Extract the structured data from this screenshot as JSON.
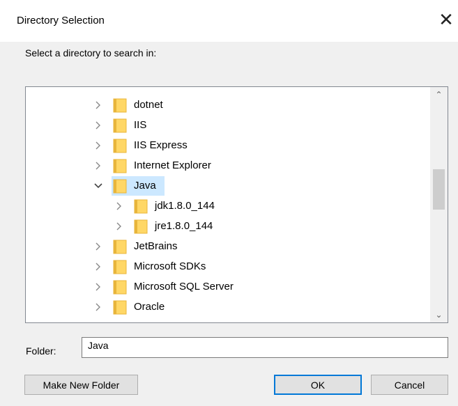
{
  "dialog": {
    "title": "Directory Selection",
    "close_glyph": "✕",
    "prompt": "Select a directory to search in:"
  },
  "tree": {
    "items": [
      {
        "label": "dotnet",
        "level": 0,
        "expanded": false,
        "selected": false
      },
      {
        "label": "IIS",
        "level": 0,
        "expanded": false,
        "selected": false
      },
      {
        "label": "IIS Express",
        "level": 0,
        "expanded": false,
        "selected": false
      },
      {
        "label": "Internet Explorer",
        "level": 0,
        "expanded": false,
        "selected": false
      },
      {
        "label": "Java",
        "level": 0,
        "expanded": true,
        "selected": true
      },
      {
        "label": "jdk1.8.0_144",
        "level": 1,
        "expanded": false,
        "selected": false
      },
      {
        "label": "jre1.8.0_144",
        "level": 1,
        "expanded": false,
        "selected": false
      },
      {
        "label": "JetBrains",
        "level": 0,
        "expanded": false,
        "selected": false
      },
      {
        "label": "Microsoft SDKs",
        "level": 0,
        "expanded": false,
        "selected": false
      },
      {
        "label": "Microsoft SQL Server",
        "level": 0,
        "expanded": false,
        "selected": false
      },
      {
        "label": "Oracle",
        "level": 0,
        "expanded": false,
        "selected": false
      }
    ],
    "scroll_up_glyph": "⌃",
    "scroll_down_glyph": "⌄"
  },
  "folder": {
    "label": "Folder:",
    "value": "Java"
  },
  "buttons": {
    "make_new_folder": "Make New Folder",
    "ok": "OK",
    "cancel": "Cancel"
  },
  "colors": {
    "selection": "#cce8ff",
    "folder_fill": "#ffd766",
    "folder_dark": "#e8b53b",
    "default_button_border": "#0078d7"
  }
}
